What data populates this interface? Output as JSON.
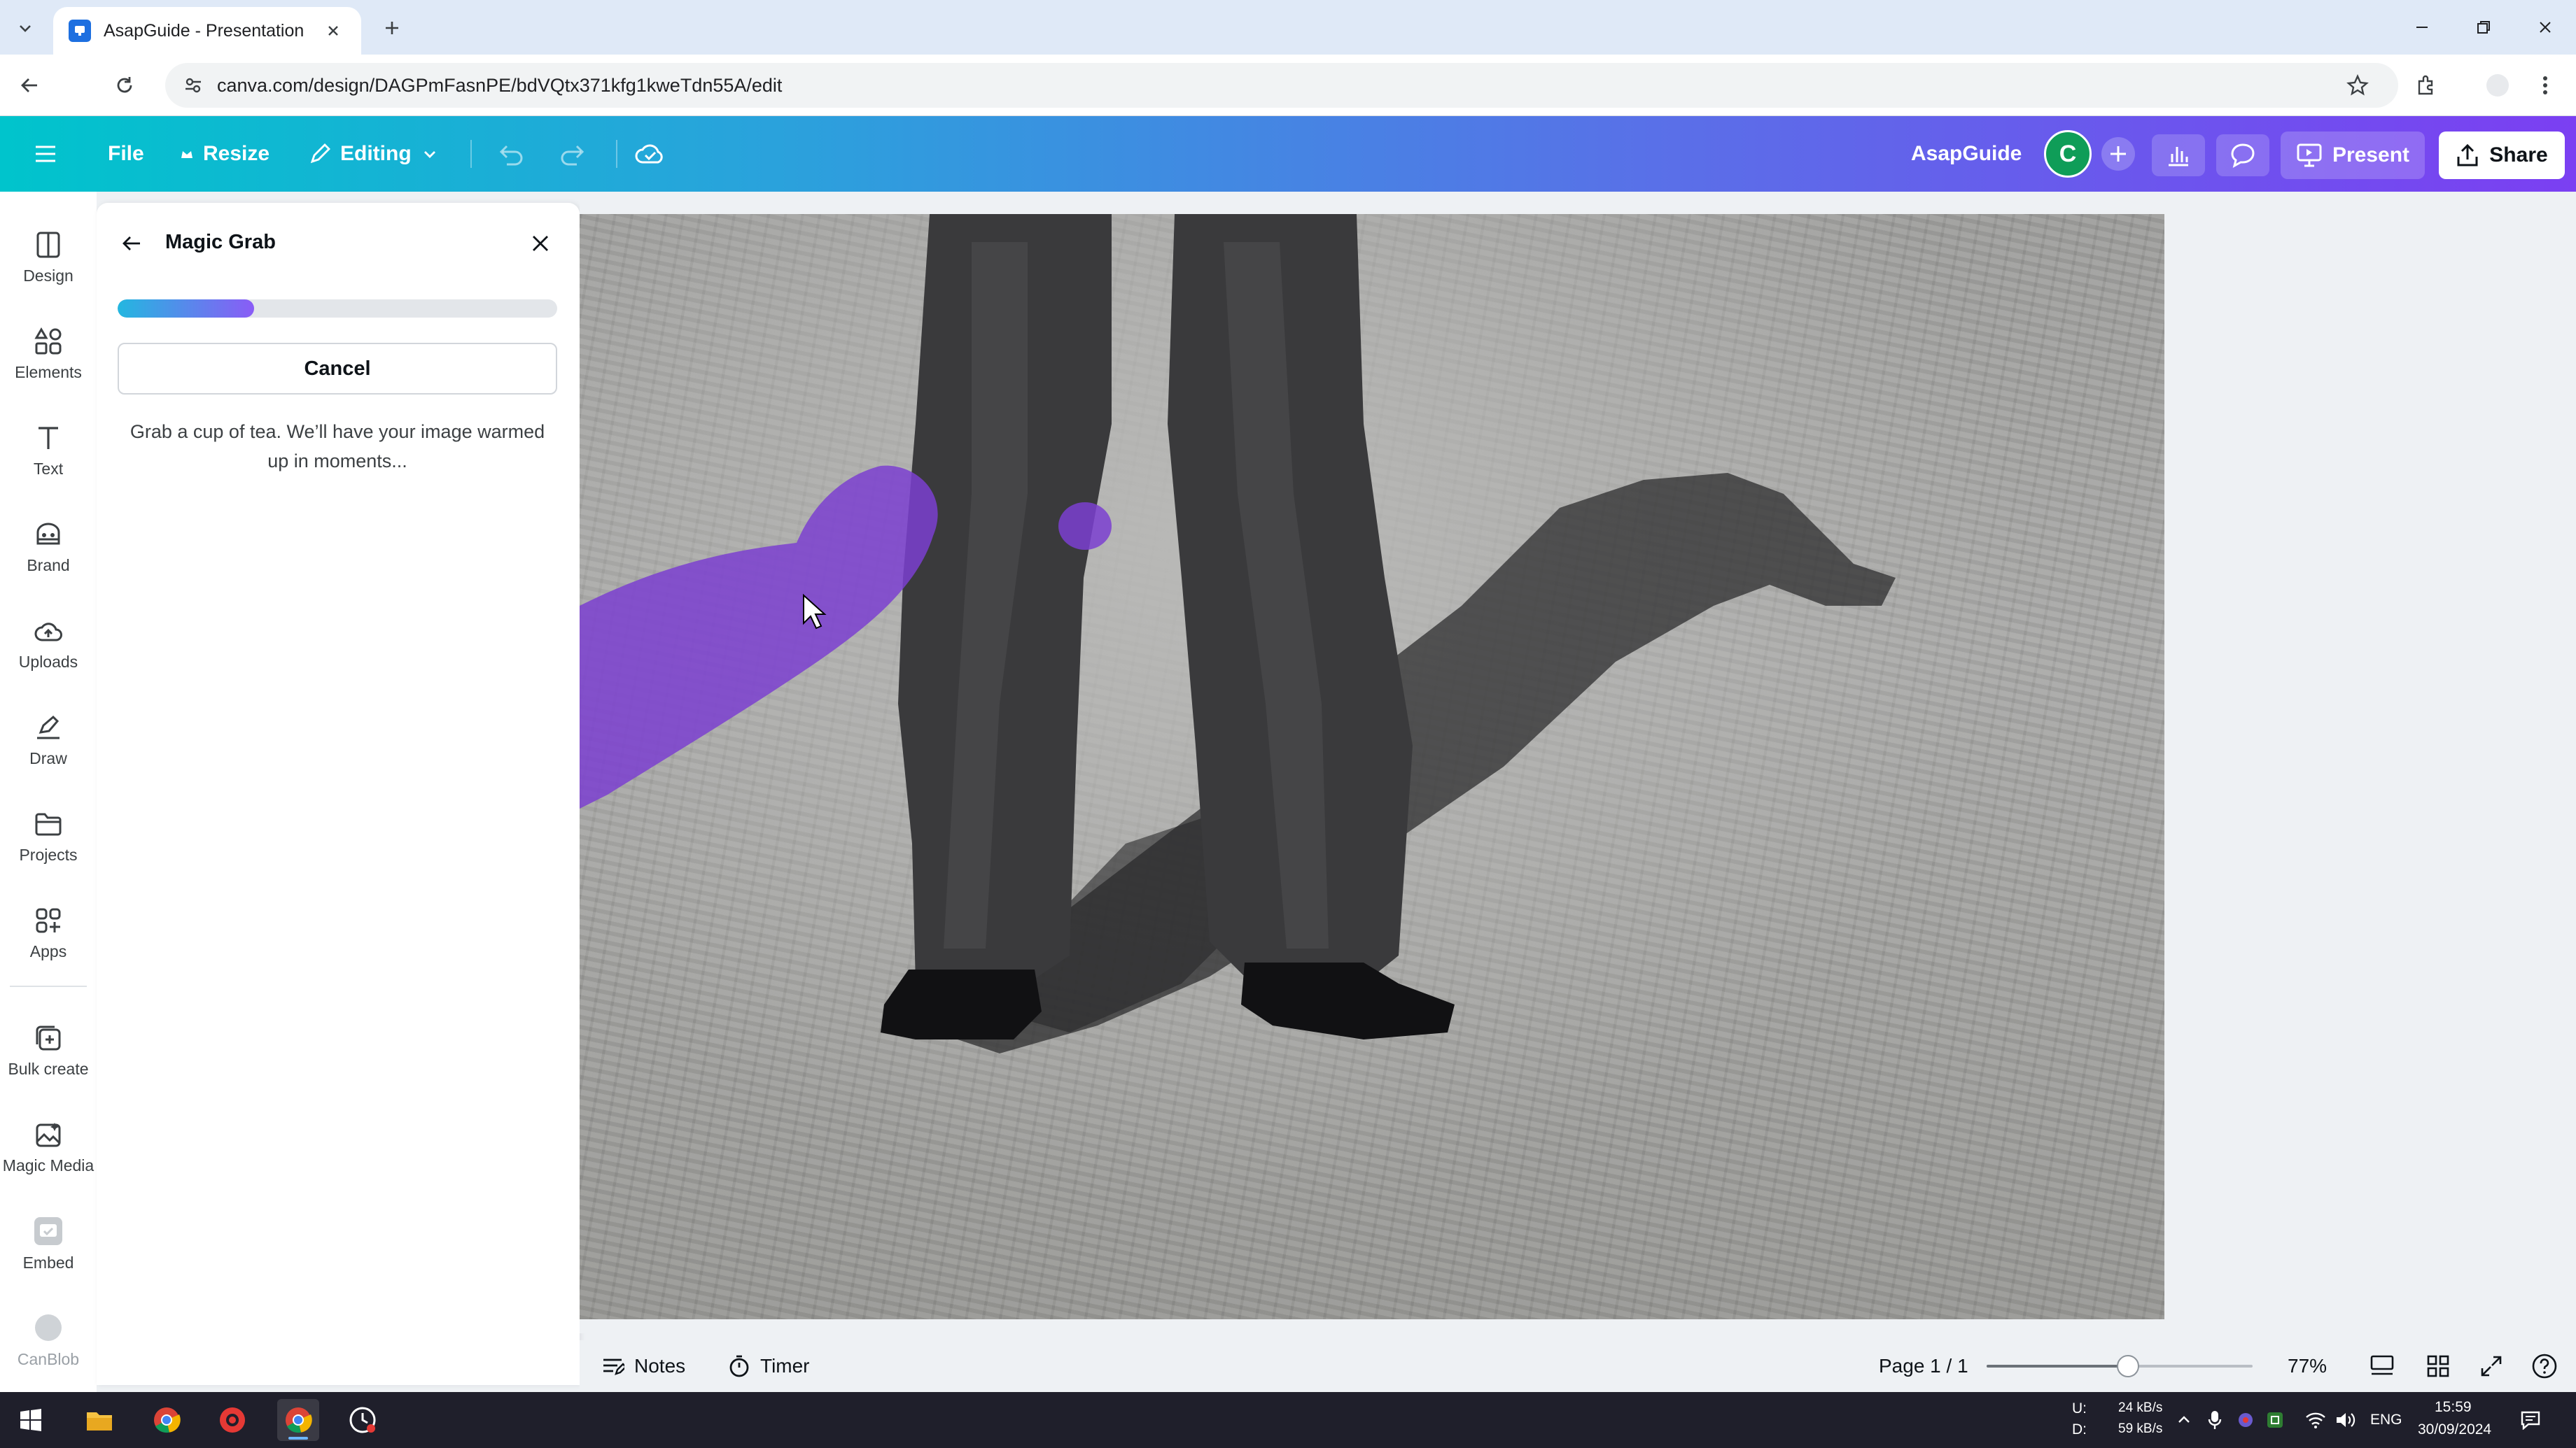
{
  "browser": {
    "tab_title": "AsapGuide - Presentation",
    "url": "canva.com/design/DAGPmFasnPE/bdVQtx371kfg1kweTdn55A/edit"
  },
  "topbar": {
    "menu_icon": "hamburger-icon",
    "file_label": "File",
    "resize_label": "Resize",
    "editing_label": "Editing",
    "team_name": "AsapGuide",
    "avatar_initial": "C",
    "present_label": "Present",
    "share_label": "Share"
  },
  "rail": {
    "items": [
      {
        "label": "Design",
        "icon": "design-icon"
      },
      {
        "label": "Elements",
        "icon": "elements-icon"
      },
      {
        "label": "Text",
        "icon": "text-icon"
      },
      {
        "label": "Brand",
        "icon": "brand-icon"
      },
      {
        "label": "Uploads",
        "icon": "uploads-icon"
      },
      {
        "label": "Draw",
        "icon": "draw-icon"
      },
      {
        "label": "Projects",
        "icon": "projects-icon"
      },
      {
        "label": "Apps",
        "icon": "apps-icon"
      },
      {
        "label": "Bulk create",
        "icon": "bulk-create-icon"
      },
      {
        "label": "Magic Media",
        "icon": "magic-media-icon"
      },
      {
        "label": "Embed",
        "icon": "embed-icon"
      },
      {
        "label": "CanBlob",
        "icon": "canblob-icon"
      }
    ]
  },
  "panel": {
    "title": "Magic Grab",
    "progress_percent": 31,
    "cancel_label": "Cancel",
    "message": "Grab a cup of tea. We’ll have your image warmed up in moments..."
  },
  "bottombar": {
    "notes_label": "Notes",
    "timer_label": "Timer",
    "page_label": "Page 1 / 1",
    "zoom_percent": 77,
    "zoom_label": "77%"
  },
  "taskbar": {
    "net_up_label": "U:",
    "net_down_label": "D:",
    "net_up": "24 kB/s",
    "net_down": "59 kB/s",
    "language": "ENG",
    "time": "15:59",
    "date": "30/09/2024"
  },
  "colors": {
    "topbar_start": "#00c4cc",
    "topbar_end": "#7b3ff2",
    "selection_purple": "#7b3fd0",
    "avatar_green": "#0f9d58"
  }
}
